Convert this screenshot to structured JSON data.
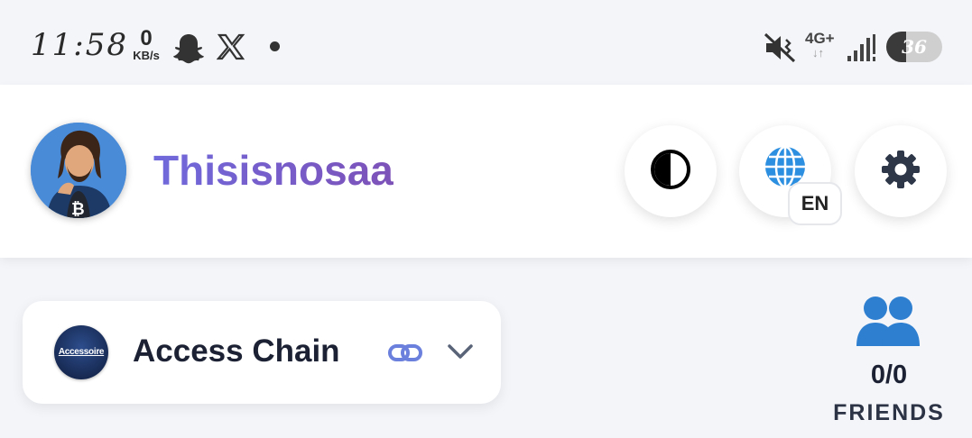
{
  "status_bar": {
    "time": "11:58",
    "net_speed_value": "0",
    "net_speed_unit": "KB/s",
    "network": "4G+",
    "network_arrows": "↓↑",
    "battery_level": "36",
    "icons": [
      "snapchat-ghost-icon",
      "x-logo-icon",
      "notification-dot-icon",
      "mute-icon",
      "signal-icon"
    ]
  },
  "header": {
    "username": "Thisisnosaa",
    "language_code": "EN",
    "buttons": [
      "theme-toggle-icon",
      "globe-icon",
      "gear-icon"
    ]
  },
  "chain_selector": {
    "logo_text": "Accessoire",
    "name": "Access Chain",
    "icons": [
      "link-icon",
      "chevron-down-icon"
    ]
  },
  "friends": {
    "count": "0/0",
    "label": "FRIENDS",
    "icon": "users-icon"
  },
  "colors": {
    "accent_gradient_start": "#7069dc",
    "accent_gradient_end": "#7d52b8",
    "friends_icon": "#2f7fd0",
    "link_icon": "#6b7fdc",
    "globe_icon": "#2d8fe0"
  }
}
